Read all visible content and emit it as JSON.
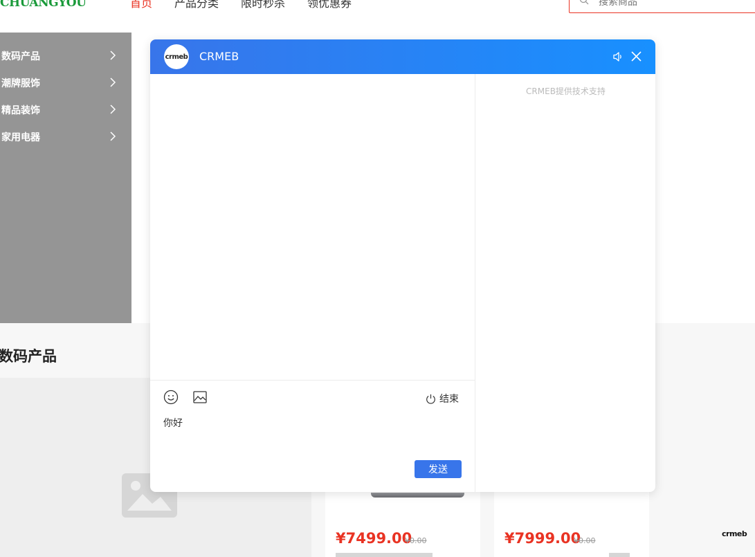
{
  "header": {
    "logo_text": "CHUANGYOU",
    "nav": [
      "首页",
      "产品分类",
      "限时秒杀",
      "领优惠券"
    ],
    "search_placeholder": "搜索商品"
  },
  "category_menu": {
    "items": [
      "数码产品",
      "潮牌服饰",
      "精品装饰",
      "家用电器"
    ]
  },
  "section": {
    "title": "数码产品"
  },
  "products": [
    {
      "price": "¥7499.00",
      "old_price": "¥0.00"
    },
    {
      "price": "¥7999.00",
      "old_price": "¥0.00"
    }
  ],
  "brand_corner": "crmeb",
  "chat": {
    "avatar_text": "crmeb",
    "title": "CRMEB",
    "support_text": "CRMEB提供技术支持",
    "end_label": "结束",
    "input_value": "你好",
    "send_label": "发送"
  },
  "colors": {
    "brand_red": "#e93323",
    "chat_blue": "#3875ea",
    "chat_header_end": "#1890ff",
    "sidebar_gray": "#959595"
  }
}
